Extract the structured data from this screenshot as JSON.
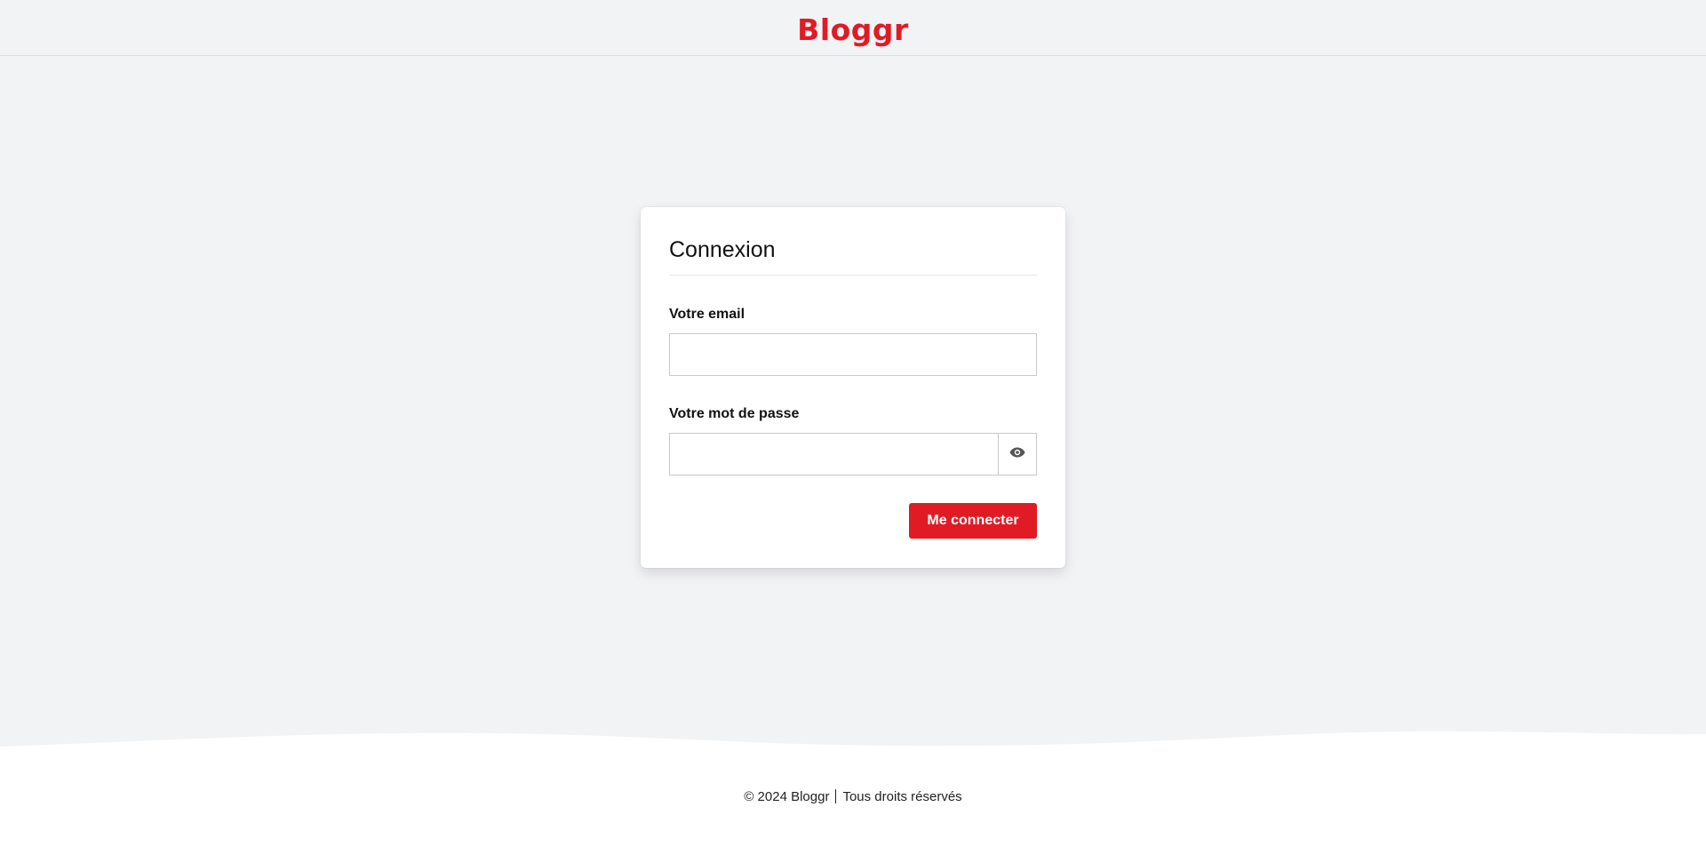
{
  "header": {
    "logo_text": "Bloggr"
  },
  "login": {
    "title": "Connexion",
    "email_label": "Votre email",
    "email_value": "",
    "password_label": "Votre mot de passe",
    "password_value": "",
    "password_toggle_icon": "eye-icon",
    "submit_label": "Me connecter"
  },
  "footer": {
    "copyright": "© 2024 Bloggr",
    "rights": "Tous droits réservés"
  },
  "colors": {
    "brand": "#e01b24",
    "background": "#f2f3f5",
    "card": "#ffffff"
  }
}
